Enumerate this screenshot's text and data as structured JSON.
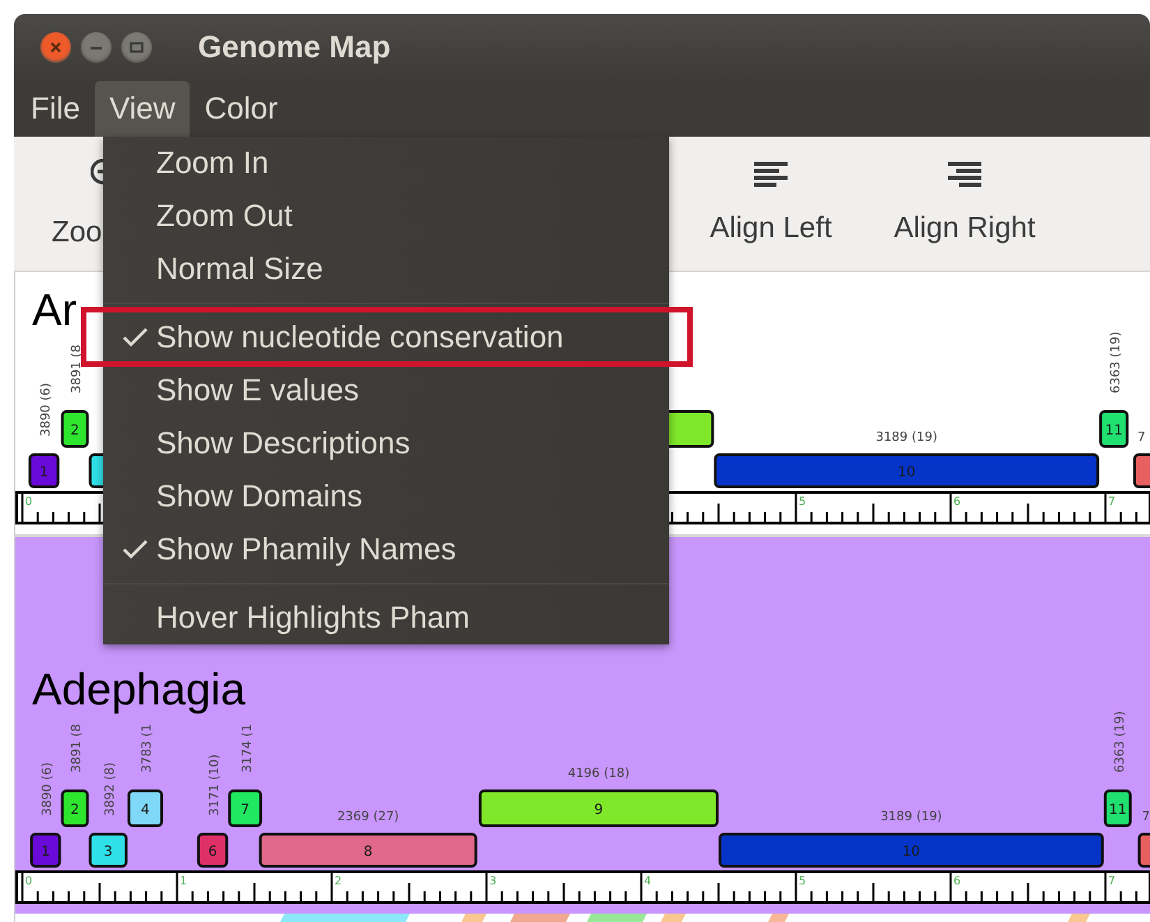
{
  "window": {
    "title": "Genome Map"
  },
  "menu_bar": [
    {
      "label": "File",
      "selected": false
    },
    {
      "label": "View",
      "selected": true
    },
    {
      "label": "Color",
      "selected": false
    }
  ],
  "toolbar": [
    {
      "label": "Zoo",
      "kind": "zoom"
    },
    {
      "label": "Align Left",
      "kind": "align-left"
    },
    {
      "label": "Align Right",
      "kind": "align-right"
    }
  ],
  "view_menu": [
    {
      "label": "Zoom In",
      "checked": false,
      "highlighted": false,
      "separator_before": false
    },
    {
      "label": "Zoom Out",
      "checked": false,
      "highlighted": false,
      "separator_before": false
    },
    {
      "label": "Normal Size",
      "checked": false,
      "highlighted": false,
      "separator_before": false
    },
    {
      "label": "Show nucleotide conservation",
      "checked": true,
      "highlighted": true,
      "separator_before": true
    },
    {
      "label": "Show E values",
      "checked": false,
      "highlighted": false,
      "separator_before": false
    },
    {
      "label": "Show Descriptions",
      "checked": false,
      "highlighted": false,
      "separator_before": false
    },
    {
      "label": "Show Domains",
      "checked": false,
      "highlighted": false,
      "separator_before": false
    },
    {
      "label": "Show Phamily Names",
      "checked": true,
      "highlighted": false,
      "separator_before": false
    },
    {
      "label": "Hover Highlights Pham",
      "checked": false,
      "highlighted": false,
      "separator_before": true
    }
  ],
  "tracks": [
    {
      "name": "Ar",
      "color": "#ffffff",
      "ruler_labels": [
        "0",
        "5",
        "6",
        "7"
      ],
      "genes": [
        {
          "number": "1",
          "label": "3890 (6)",
          "color": "#6a0ad8"
        },
        {
          "number": "2",
          "label": "3891 (8",
          "color": "#2ee62e"
        },
        {
          "color": "#30e0e8"
        },
        {
          "color": "#80e82a"
        },
        {
          "number": "10",
          "label": "3189 (19)",
          "color": "#0634c8"
        },
        {
          "number": "11",
          "label": "6363 (19)",
          "color": "#20e070"
        },
        {
          "label": "7",
          "color": "#e86060"
        }
      ]
    },
    {
      "name": "Adephagia",
      "color": "#c896fc",
      "ruler_labels": [
        "0",
        "1",
        "2",
        "3",
        "4",
        "5",
        "6",
        "7"
      ],
      "genes": [
        {
          "number": "1",
          "label": "3890 (6)",
          "color": "#6a0ad8"
        },
        {
          "number": "2",
          "label": "3891 (8",
          "color": "#2ee62e"
        },
        {
          "number": "3",
          "label": "3892 (8)",
          "color": "#30e0e8"
        },
        {
          "number": "4",
          "label": "3783 (1",
          "color": "#80d8f8"
        },
        {
          "number": "6",
          "label": "3171 (10)",
          "color": "#e0306a"
        },
        {
          "number": "7",
          "label": "3174 (1",
          "color": "#20e860"
        },
        {
          "number": "8",
          "label": "2369 (27)",
          "color": "#e06888"
        },
        {
          "number": "9",
          "label": "4196 (18)",
          "color": "#80e82a"
        },
        {
          "number": "10",
          "label": "3189 (19)",
          "color": "#0634c8"
        },
        {
          "number": "11",
          "label": "6363 (19)",
          "color": "#20e070"
        },
        {
          "label": "7",
          "color": "#e86060"
        }
      ]
    }
  ]
}
